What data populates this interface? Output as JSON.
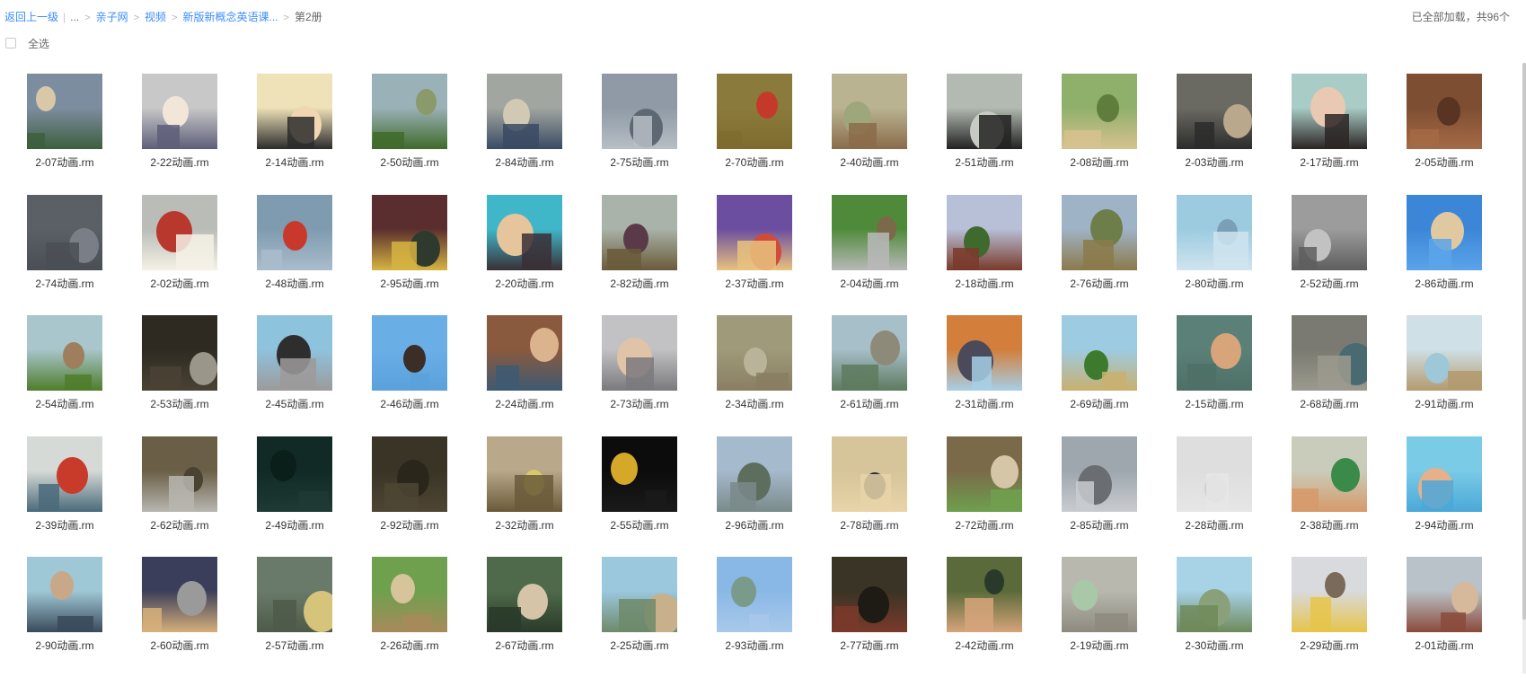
{
  "breadcrumb": {
    "back": "返回上一级",
    "ellipsis": "...",
    "items": [
      "亲子网",
      "视频",
      "新版新概念英语课...",
      "第2册"
    ]
  },
  "status": "已全部加载，共96个",
  "select_all": "全选",
  "files": [
    {
      "name": "2-07动画.rm",
      "colors": [
        "#7d8da0",
        "#3e5f3e",
        "#d8c8a8"
      ]
    },
    {
      "name": "2-22动画.rm",
      "colors": [
        "#c8c8c8",
        "#5e5e7a",
        "#f2e6d8"
      ]
    },
    {
      "name": "2-14动画.rm",
      "colors": [
        "#efe2b8",
        "#2b2b2b",
        "#f1d6b2"
      ]
    },
    {
      "name": "2-50动画.rm",
      "colors": [
        "#9bb1b8",
        "#3f6b2a",
        "#8b9a6a"
      ]
    },
    {
      "name": "2-84动画.rm",
      "colors": [
        "#a2a6a0",
        "#394a63",
        "#d2c9b4"
      ]
    },
    {
      "name": "2-75动画.rm",
      "colors": [
        "#8f9aa6",
        "#b7bec4",
        "#5d6873"
      ]
    },
    {
      "name": "2-70动画.rm",
      "colors": [
        "#8a7a3c",
        "#7e6c2e",
        "#c43a2a"
      ]
    },
    {
      "name": "2-40动画.rm",
      "colors": [
        "#b9b391",
        "#8b6b4a",
        "#9ea67c"
      ]
    },
    {
      "name": "2-51动画.rm",
      "colors": [
        "#b2bab1",
        "#222222",
        "#c6cbc3"
      ]
    },
    {
      "name": "2-08动画.rm",
      "colors": [
        "#8fb06a",
        "#d6c28e",
        "#5f7d3c"
      ]
    },
    {
      "name": "2-03动画.rm",
      "colors": [
        "#6b6a62",
        "#2c2c2c",
        "#b9a88c"
      ]
    },
    {
      "name": "2-17动画.rm",
      "colors": [
        "#a9ccc6",
        "#2b2424",
        "#e9c9b3"
      ]
    },
    {
      "name": "2-05动画.rm",
      "colors": [
        "#7e4e33",
        "#a56a45",
        "#5a3422"
      ]
    },
    {
      "name": "2-74动画.rm",
      "colors": [
        "#5b5f66",
        "#4a4e55",
        "#7a7e86"
      ]
    },
    {
      "name": "2-02动画.rm",
      "colors": [
        "#b9bcb7",
        "#f5f1e6",
        "#b8382e"
      ]
    },
    {
      "name": "2-48动画.rm",
      "colors": [
        "#7e9bb0",
        "#a9bccb",
        "#c8392b"
      ]
    },
    {
      "name": "2-95动画.rm",
      "colors": [
        "#5a2e2e",
        "#d6b442",
        "#2f3a2f"
      ]
    },
    {
      "name": "2-20动画.rm",
      "colors": [
        "#3fb7c9",
        "#3a2f36",
        "#e6c49c"
      ]
    },
    {
      "name": "2-82动画.rm",
      "colors": [
        "#a9b3a9",
        "#6a5a3a",
        "#5a3a48"
      ]
    },
    {
      "name": "2-37动画.rm",
      "colors": [
        "#6b4ea0",
        "#e8c27e",
        "#d24a3a"
      ]
    },
    {
      "name": "2-04动画.rm",
      "colors": [
        "#4f8a3a",
        "#b8b8b8",
        "#7a6a4a"
      ]
    },
    {
      "name": "2-18动画.rm",
      "colors": [
        "#b8c0d8",
        "#7a3a2a",
        "#3e6a2e"
      ]
    },
    {
      "name": "2-76动画.rm",
      "colors": [
        "#9fb3c6",
        "#8b7a4a",
        "#6e7e4a"
      ]
    },
    {
      "name": "2-80动画.rm",
      "colors": [
        "#9ccbe0",
        "#cfe4ee",
        "#7aa0b8"
      ]
    },
    {
      "name": "2-52动画.rm",
      "colors": [
        "#9c9c9c",
        "#5e5e5e",
        "#c2c2c2"
      ]
    },
    {
      "name": "2-86动画.rm",
      "colors": [
        "#3c86d8",
        "#5aa4ea",
        "#e0c9a0"
      ]
    },
    {
      "name": "2-54动画.rm",
      "colors": [
        "#a8c6cc",
        "#4f7d2a",
        "#9e7e5c"
      ]
    },
    {
      "name": "2-53动画.rm",
      "colors": [
        "#2e2a22",
        "#4a4234",
        "#9a968a"
      ]
    },
    {
      "name": "2-45动画.rm",
      "colors": [
        "#8ec3de",
        "#9c9a9a",
        "#2e2e2e"
      ]
    },
    {
      "name": "2-46动画.rm",
      "colors": [
        "#6aaee6",
        "#5aa1dc",
        "#3a2e26"
      ]
    },
    {
      "name": "2-24动画.rm",
      "colors": [
        "#8a5a3e",
        "#3e5a72",
        "#dbb48e"
      ]
    },
    {
      "name": "2-73动画.rm",
      "colors": [
        "#c2c2c4",
        "#7a7a7e",
        "#e0c4a8"
      ]
    },
    {
      "name": "2-34动画.rm",
      "colors": [
        "#9e9a7a",
        "#8a7e62",
        "#b9b399"
      ]
    },
    {
      "name": "2-61动画.rm",
      "colors": [
        "#a7bfc9",
        "#5e7a5e",
        "#8e8a7a"
      ]
    },
    {
      "name": "2-31动画.rm",
      "colors": [
        "#d37e3a",
        "#a7cfe6",
        "#4a4a5a"
      ]
    },
    {
      "name": "2-69动画.rm",
      "colors": [
        "#9ccbe2",
        "#c9b06e",
        "#3e7a2e"
      ]
    },
    {
      "name": "2-15动画.rm",
      "colors": [
        "#5a8078",
        "#4e7066",
        "#d8a47a"
      ]
    },
    {
      "name": "2-68动画.rm",
      "colors": [
        "#7a7a72",
        "#9c9a8e",
        "#4a6a72"
      ]
    },
    {
      "name": "2-91动画.rm",
      "colors": [
        "#cfe0e6",
        "#b39a6e",
        "#9ec7d8"
      ]
    },
    {
      "name": "2-39动画.rm",
      "colors": [
        "#d6dad6",
        "#4a6a7a",
        "#c83a2a"
      ]
    },
    {
      "name": "2-62动画.rm",
      "colors": [
        "#6a5e46",
        "#b8b6b0",
        "#4a4232"
      ]
    },
    {
      "name": "2-49动画.rm",
      "colors": [
        "#112a26",
        "#1e3a34",
        "#0a1e1a"
      ]
    },
    {
      "name": "2-92动画.rm",
      "colors": [
        "#3a3426",
        "#4e4632",
        "#2a261c"
      ]
    },
    {
      "name": "2-32动画.rm",
      "colors": [
        "#b9a88a",
        "#6a5a3a",
        "#d8c86a"
      ]
    },
    {
      "name": "2-55动画.rm",
      "colors": [
        "#0c0c0c",
        "#1a1a1a",
        "#d6a82a"
      ]
    },
    {
      "name": "2-96动画.rm",
      "colors": [
        "#a6bacd",
        "#7a8a8a",
        "#5e6e5e"
      ]
    },
    {
      "name": "2-78动画.rm",
      "colors": [
        "#d6c49a",
        "#e8d4a8",
        "#2a2a3a"
      ]
    },
    {
      "name": "2-72动画.rm",
      "colors": [
        "#7a6a4a",
        "#6ea04e",
        "#d6c6a8"
      ]
    },
    {
      "name": "2-85动画.rm",
      "colors": [
        "#9ea6ae",
        "#c8ccd0",
        "#6a6e72"
      ]
    },
    {
      "name": "2-28动画.rm",
      "colors": [
        "#dedede",
        "#e6e6e6",
        "#cfcfcf"
      ]
    },
    {
      "name": "2-38动画.rm",
      "colors": [
        "#c9ccba",
        "#d69a6a",
        "#3a8a4a"
      ]
    },
    {
      "name": "2-94动画.rm",
      "colors": [
        "#7acbe6",
        "#4aa8d8",
        "#e6b08a"
      ]
    },
    {
      "name": "2-90动画.rm",
      "colors": [
        "#9fc8d6",
        "#3a4a5a",
        "#c8a888"
      ]
    },
    {
      "name": "2-60动画.rm",
      "colors": [
        "#3a3e5a",
        "#d6b07a",
        "#9a9a9a"
      ]
    },
    {
      "name": "2-57动画.rm",
      "colors": [
        "#6a7a6a",
        "#4e5a4a",
        "#d6c47a"
      ]
    },
    {
      "name": "2-26动画.rm",
      "colors": [
        "#6ea04e",
        "#a88a5a",
        "#d6c49a"
      ]
    },
    {
      "name": "2-67动画.rm",
      "colors": [
        "#4e6a4a",
        "#2a3a2a",
        "#d6c4a8"
      ]
    },
    {
      "name": "2-25动画.rm",
      "colors": [
        "#9cc8de",
        "#6e8a6a",
        "#c8b08a"
      ]
    },
    {
      "name": "2-93动画.rm",
      "colors": [
        "#8ab8e6",
        "#a8c8ea",
        "#7a9a8a"
      ]
    },
    {
      "name": "2-77动画.rm",
      "colors": [
        "#3a3426",
        "#7a3a2a",
        "#1e1a14"
      ]
    },
    {
      "name": "2-42动画.rm",
      "colors": [
        "#5a6a3a",
        "#d6a47a",
        "#2a3a2a"
      ]
    },
    {
      "name": "2-19动画.rm",
      "colors": [
        "#b8b8ae",
        "#8e8a7e",
        "#a8c8a8"
      ]
    },
    {
      "name": "2-30动画.rm",
      "colors": [
        "#a8d2e6",
        "#6e8a5a",
        "#8aa07a"
      ]
    },
    {
      "name": "2-29动画.rm",
      "colors": [
        "#d8dade",
        "#e6c44a",
        "#7a6a5a"
      ]
    },
    {
      "name": "2-01动画.rm",
      "colors": [
        "#b9c2c8",
        "#8a4a3a",
        "#d6b89a"
      ]
    }
  ]
}
